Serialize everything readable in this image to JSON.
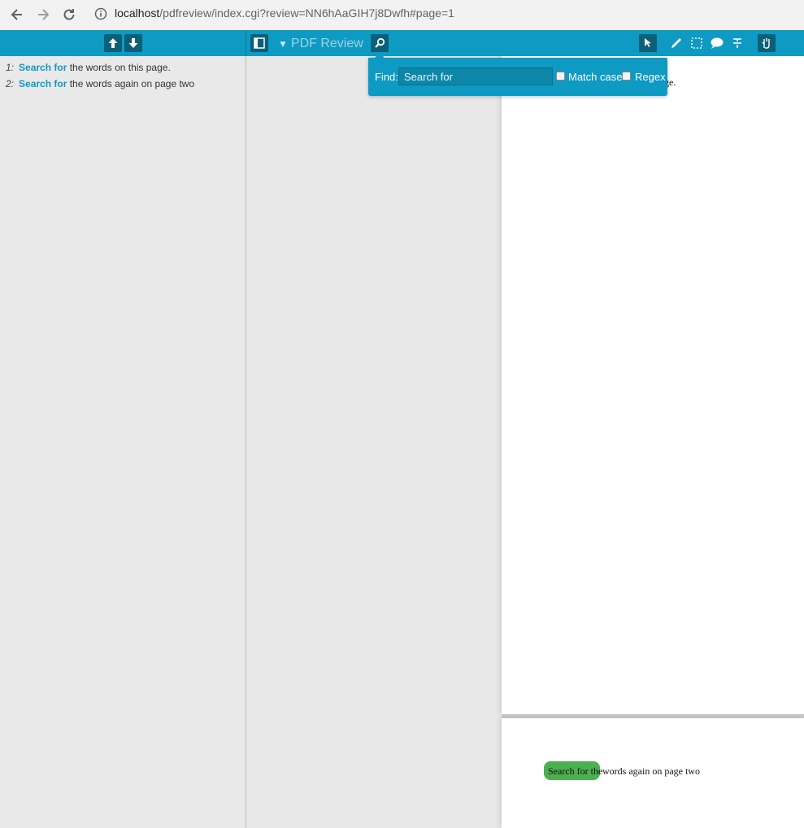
{
  "browser": {
    "url_host": "localhost",
    "url_path": "/pdfreview/index.cgi?review=NN6hAaGIH7j8Dwfh#page=1"
  },
  "toolbar": {
    "title": "PDF Review",
    "caret": "▼"
  },
  "find": {
    "label": "Find:",
    "value": "Search for",
    "match_case_label": "Match case",
    "regex_label": "Regex",
    "match_case_checked": false,
    "regex_checked": false
  },
  "sidebar": {
    "results": [
      {
        "num": "1:",
        "hit": "Search for",
        "rest": " the words on this page."
      },
      {
        "num": "2:",
        "hit": "Search for",
        "rest": " the words again on page two"
      }
    ]
  },
  "document": {
    "page1_visible_text": "ge.",
    "page2_highlight_text": "Search for the",
    "page2_rest_text": " words again on page two"
  },
  "colors": {
    "accent": "#0e9ac2",
    "highlight": "#4caf50"
  }
}
